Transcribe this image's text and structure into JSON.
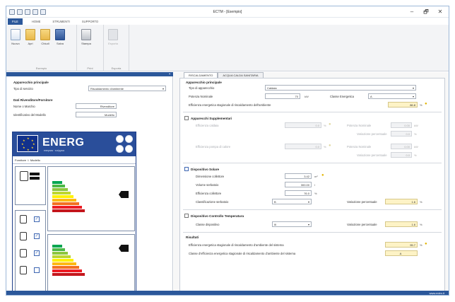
{
  "window": {
    "title": "ECTM - [Esempio]",
    "controls": [
      "–",
      "🗗",
      "✕"
    ]
  },
  "ribbon": {
    "tabs": [
      "FILE",
      "HOME",
      "STRUMENTI",
      "SUPPORTO"
    ],
    "groups": [
      {
        "label": "Esempio",
        "buttons": [
          {
            "label": "Nuovo"
          },
          {
            "label": "Apri"
          },
          {
            "label": "Chiudi"
          },
          {
            "label": "Salva"
          }
        ]
      },
      {
        "label": "Print",
        "buttons": [
          {
            "label": "Stampa"
          }
        ]
      },
      {
        "label": "Esporta",
        "buttons": [
          {
            "label": "Esporta"
          }
        ]
      }
    ]
  },
  "left": {
    "sec1": "Apparecchio principale",
    "tipo_label": "Tipo di servizio",
    "tipo_value": "Riscaldamento d'ambiente",
    "sec2": "Dati Rivenditore/Fornitore",
    "nome_label": "Nome o Marchio",
    "nome_value": "Rivenditore",
    "ident_label": "Identificativo del Modello",
    "ident_value": "Modello",
    "card": {
      "energ": "ENERG",
      "sub": "енергия · ενέργεια",
      "model_row": "Fornitore ☆ Modello"
    }
  },
  "right": {
    "tabs": [
      "RISCALDAMENTO",
      "ACQUA CALDA SANITARIA"
    ],
    "sec_main": "Apparecchio principale",
    "tipo_label": "Tipo di apparecchio",
    "tipo_value": "Caldaia",
    "potenza_label": "Potenza Nominale",
    "potenza_value": "70",
    "potenza_unit": "kW",
    "classe_label": "Classe Energetica",
    "classe_value": "A",
    "eff_label": "Efficienza energetica stagionale di riscaldamento dell'ambiente",
    "eff_value": "86.8",
    "eff_unit": "%",
    "sec_supp": "Apparecchi Supplementari",
    "supp_label1": "Efficienza caldaia",
    "supp_label2": "Efficienza pompa di calore",
    "supp_right_a": "Potenza Nominale",
    "supp_right_b": "Variazione percentuale",
    "supp_val": "0.0",
    "supp_pct": "%",
    "supp_kw": "0.00",
    "supp_kw_unit": "kW",
    "sec_solar": "Dispositivo Solare",
    "solar_l1": "Dimensione collettore",
    "solar_l2": "Volume serbatoio",
    "solar_l3": "Efficienza collettore",
    "solar_l4": "Classificazione serbatoio",
    "solar_v1": "3.42",
    "solar_u1": "m²",
    "solar_v2": "300.00",
    "solar_u2": "l",
    "solar_v3": "76.0",
    "solar_u3": "%",
    "solar_v4": "B",
    "solar_var_label": "Variazione percentuale",
    "solar_var_value": "1.6",
    "sec_temp": "Dispositivo Controllo Temperatura",
    "temp_l1": "Classe dispositivo",
    "temp_v1": "III",
    "temp_var_label": "Variazione percentuale",
    "temp_var_value": "1.6",
    "sec_res": "Risultati",
    "res_l1": "Efficienza energetica stagionale di riscaldamento d'ambiente del sistema",
    "res_l2": "Classe d'efficienza energetica stagionale di riscaldamento d'ambiente del sistema",
    "res_v1": "95.7",
    "res_u1": "%",
    "res_v2": "A"
  },
  "status": {
    "text": "www.ectm.it"
  },
  "colors": {
    "accent": "#2b579a",
    "label_blue": "#2a4e9a",
    "highlight": "#fdf3c6"
  }
}
